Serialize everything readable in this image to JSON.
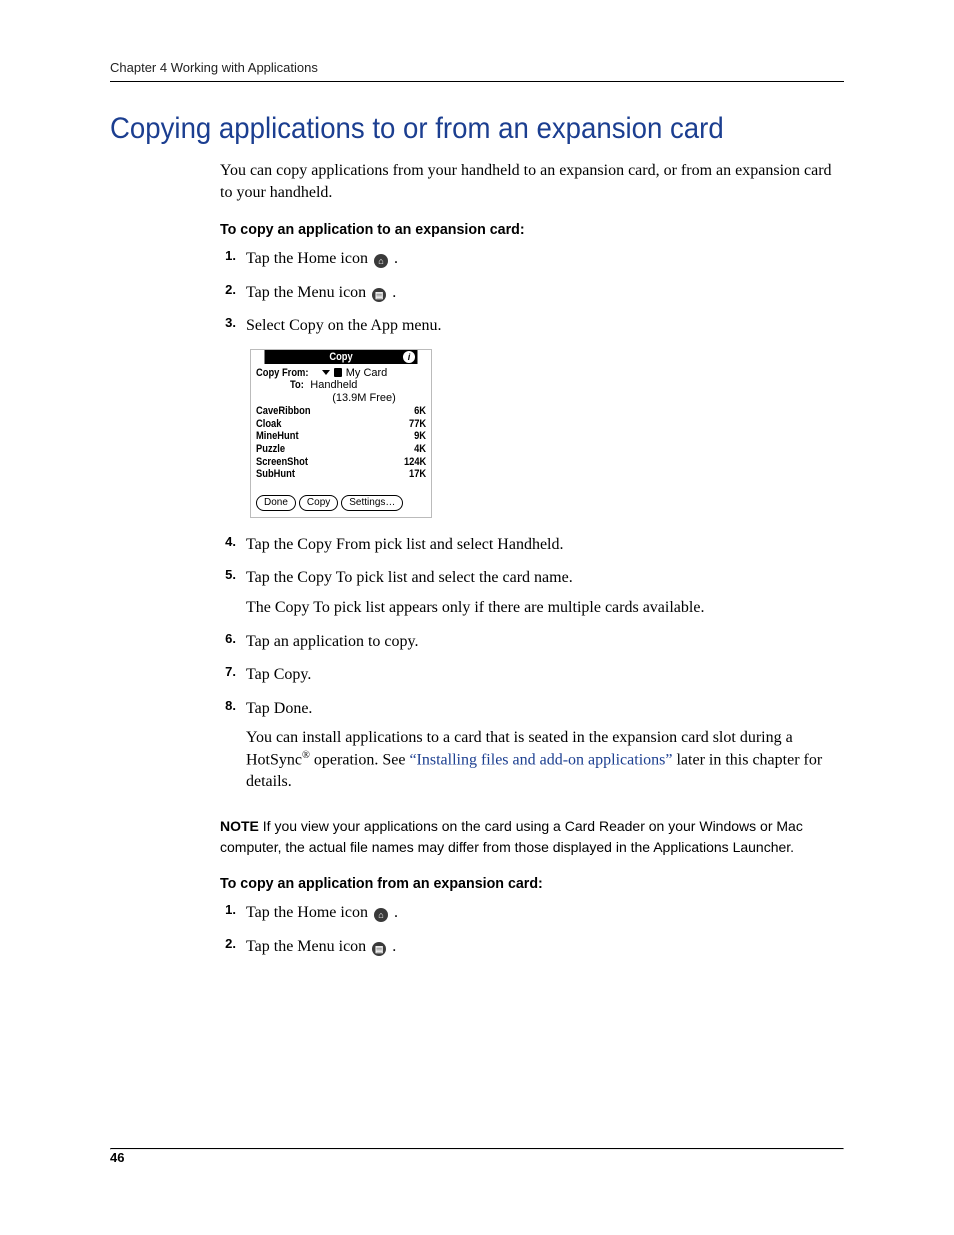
{
  "header": {
    "running_head": "Chapter 4   Working with Applications"
  },
  "h1": "Copying applications to or from an expansion card",
  "intro": "You can copy applications from your handheld to an expansion card, or from an expansion card to your handheld.",
  "proc1_title": "To copy an application to an expansion card:",
  "steps_a": {
    "s1a": "Tap the Home icon ",
    "s1b": ".",
    "s2a": "Tap the Menu icon ",
    "s2b": ".",
    "s3": "Select Copy on the App menu."
  },
  "shot": {
    "title": "Copy",
    "from_label": "Copy From:",
    "from_value": "My Card",
    "to_label": "To:",
    "to_value": "Handheld",
    "free": "(13.9M Free)",
    "apps": [
      {
        "name": "CaveRibbon",
        "size": "6K"
      },
      {
        "name": "Cloak",
        "size": "77K"
      },
      {
        "name": "MineHunt",
        "size": "9K"
      },
      {
        "name": "Puzzle",
        "size": "4K"
      },
      {
        "name": "ScreenShot",
        "size": "124K"
      },
      {
        "name": "SubHunt",
        "size": "17K"
      }
    ],
    "btn_done": "Done",
    "btn_copy": "Copy",
    "btn_settings": "Settings…"
  },
  "steps_b": {
    "s4": "Tap the Copy From pick list and select Handheld.",
    "s5": "Tap the Copy To pick list and select the card name.",
    "s5_note": "The Copy To pick list appears only if there are multiple cards available.",
    "s6": "Tap an application to copy.",
    "s7": "Tap Copy.",
    "s8": "Tap Done.",
    "s8_note_a": "You can install applications to a card that is seated in the expansion card slot during a HotSync",
    "s8_note_b": " operation. See ",
    "s8_link": "“Installing files and add-on applications”",
    "s8_note_c": " later in this chapter for details."
  },
  "note": {
    "label": "NOTE",
    "text": "   If you view your applications on the card using a Card Reader on your Windows or Mac computer, the actual file names may differ from those displayed in the Applications Launcher."
  },
  "proc2_title": "To copy an application from an expansion card:",
  "steps_c": {
    "s1a": "Tap the Home icon ",
    "s1b": ".",
    "s2a": "Tap the Menu icon ",
    "s2b": "."
  },
  "folio": "46"
}
